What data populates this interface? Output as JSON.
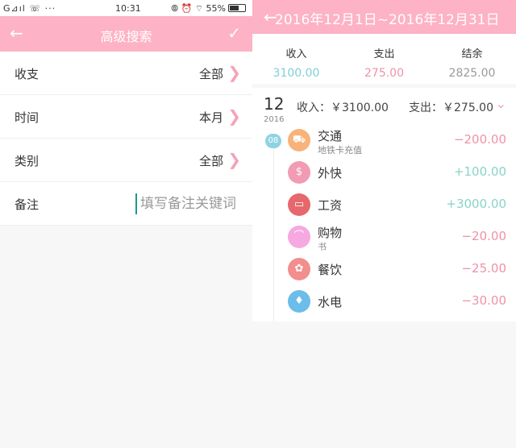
{
  "left": {
    "status": {
      "left": "G⊿ıl ☏ ···",
      "time": "10:31",
      "right": "⦾ ⏰ ⌔ 55%"
    },
    "appbar": {
      "back": "←",
      "title": "高级搜索",
      "check": "✓"
    },
    "rows": [
      {
        "label": "收支",
        "value": "全部"
      },
      {
        "label": "时间",
        "value": "本月"
      },
      {
        "label": "类别",
        "value": "全部"
      }
    ],
    "note": {
      "label": "备注",
      "placeholder": "填写备注关键词"
    },
    "chevron": "❯"
  },
  "right": {
    "header": {
      "back": "←",
      "range": "2016年12月1日~2016年12月31日"
    },
    "summary": [
      {
        "label": "收入",
        "value": "3100.00",
        "color": "#7ecfd6"
      },
      {
        "label": "支出",
        "value": "275.00",
        "color": "#f191a8"
      },
      {
        "label": "结余",
        "value": "2825.00",
        "color": "#9a9a9a"
      }
    ],
    "day": {
      "num": "12",
      "year": "2016",
      "income": "收入：￥3100.00",
      "expense": "支出：￥275.00",
      "chev": "⌄",
      "badge": "08"
    },
    "transactions": [
      {
        "name": "交通",
        "sub": "地铁卡充值",
        "amount": "−200.00",
        "kind": "out",
        "icon": "bus-icon",
        "glyph": "⛟",
        "color": "#f8b27a"
      },
      {
        "name": "外快",
        "sub": "",
        "amount": "+100.00",
        "kind": "in",
        "icon": "money-bag-icon",
        "glyph": "$",
        "color": "#f29bb4"
      },
      {
        "name": "工资",
        "sub": "",
        "amount": "+3000.00",
        "kind": "in",
        "icon": "wallet-icon",
        "glyph": "▭",
        "color": "#e6686c"
      },
      {
        "name": "购物",
        "sub": "书",
        "amount": "−20.00",
        "kind": "out",
        "icon": "shopping-icon",
        "glyph": "⌒",
        "color": "#f6a8e0"
      },
      {
        "name": "餐饮",
        "sub": "",
        "amount": "−25.00",
        "kind": "out",
        "icon": "food-icon",
        "glyph": "✿",
        "color": "#f28e8e"
      },
      {
        "name": "水电",
        "sub": "",
        "amount": "−30.00",
        "kind": "out",
        "icon": "water-drop-icon",
        "glyph": "♦",
        "color": "#6cbde9"
      }
    ],
    "colors": {
      "in": "#88d4c6",
      "out": "#f191a8"
    }
  }
}
